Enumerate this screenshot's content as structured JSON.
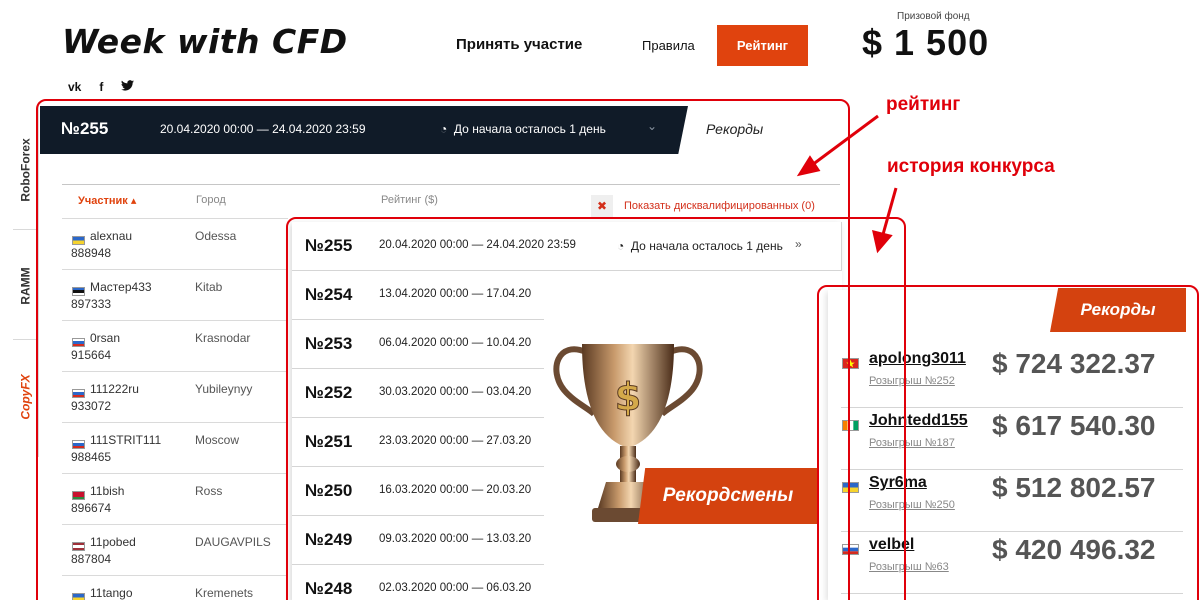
{
  "header": {
    "logo": "Week with CFD",
    "nav_join": "Принять участие",
    "nav_rules": "Правила",
    "nav_rating": "Рейтинг",
    "prize_label": "Призовой фонд",
    "prize_value": "$ 1 500",
    "social": [
      "vk",
      "f",
      "twitter-icon"
    ]
  },
  "brands": [
    "RoboForex",
    "RAMM",
    "CopyFX"
  ],
  "contest": {
    "number": "№255",
    "dates": "20.04.2020 00:00 — 24.04.2020 23:59",
    "remaining": "До начала осталось 1 день",
    "records_tab": "Рекорды"
  },
  "table": {
    "col_user": "Участник",
    "col_city": "Город",
    "col_rating": "Рейтинг ($)",
    "disq_label": "Показать дисквалифицированных (0)",
    "rows": [
      {
        "name": "alexnau",
        "id": "888948",
        "city": "Odessa",
        "flag": "ua"
      },
      {
        "name": "Мастер433",
        "id": "897333",
        "city": "Kitab",
        "flag": "ee"
      },
      {
        "name": "0rsan",
        "id": "915664",
        "city": "Krasnodar",
        "flag": "ru"
      },
      {
        "name": "111222ru",
        "id": "933072",
        "city": "Yubileynyy",
        "flag": "ru"
      },
      {
        "name": "111STRIT111",
        "id": "988465",
        "city": "Moscow",
        "flag": "ru"
      },
      {
        "name": "11bish",
        "id": "896674",
        "city": "Ross",
        "flag": "by"
      },
      {
        "name": "11pobed",
        "id": "887804",
        "city": "DAUGAVPILS",
        "flag": "lv"
      },
      {
        "name": "11tango",
        "id": "",
        "city": "Kremenets",
        "flag": "ua"
      }
    ]
  },
  "history": [
    {
      "number": "№255",
      "dates": "20.04.2020 00:00 — 24.04.2020 23:59",
      "remaining": "До начала осталось 1 день"
    },
    {
      "number": "№254",
      "dates": "13.04.2020 00:00 — 17.04.20"
    },
    {
      "number": "№253",
      "dates": "06.04.2020 00:00 — 10.04.20"
    },
    {
      "number": "№252",
      "dates": "30.03.2020 00:00 — 03.04.20"
    },
    {
      "number": "№251",
      "dates": "23.03.2020 00:00 — 27.03.20"
    },
    {
      "number": "№250",
      "dates": "16.03.2020 00:00 — 20.03.20"
    },
    {
      "number": "№249",
      "dates": "09.03.2020 00:00 — 13.03.20"
    },
    {
      "number": "№248",
      "dates": "02.03.2020 00:00 — 06.03.20"
    }
  ],
  "recordsmen_label": "Рекордсмены",
  "records": {
    "title": "Рекорды",
    "items": [
      {
        "name": "apolong3011",
        "draw": "Розыгрыш №252",
        "amount": "$ 724 322.37",
        "flag": "vn"
      },
      {
        "name": "Johntedd155",
        "draw": "Розыгрыш №187",
        "amount": "$ 617 540.30",
        "flag": "ci"
      },
      {
        "name": "Syr6ma",
        "draw": "Розыгрыш №250",
        "amount": "$ 512 802.57",
        "flag": "ua"
      },
      {
        "name": "velbel",
        "draw": "Розыгрыш №63",
        "amount": "$ 420 496.32",
        "flag": "ru"
      }
    ]
  },
  "annotations": {
    "rating": "рейтинг",
    "history": "история  конкурса"
  },
  "colors": {
    "accent": "#e0430e",
    "dark_bar": "#101b28",
    "annotation": "#e0000a"
  }
}
